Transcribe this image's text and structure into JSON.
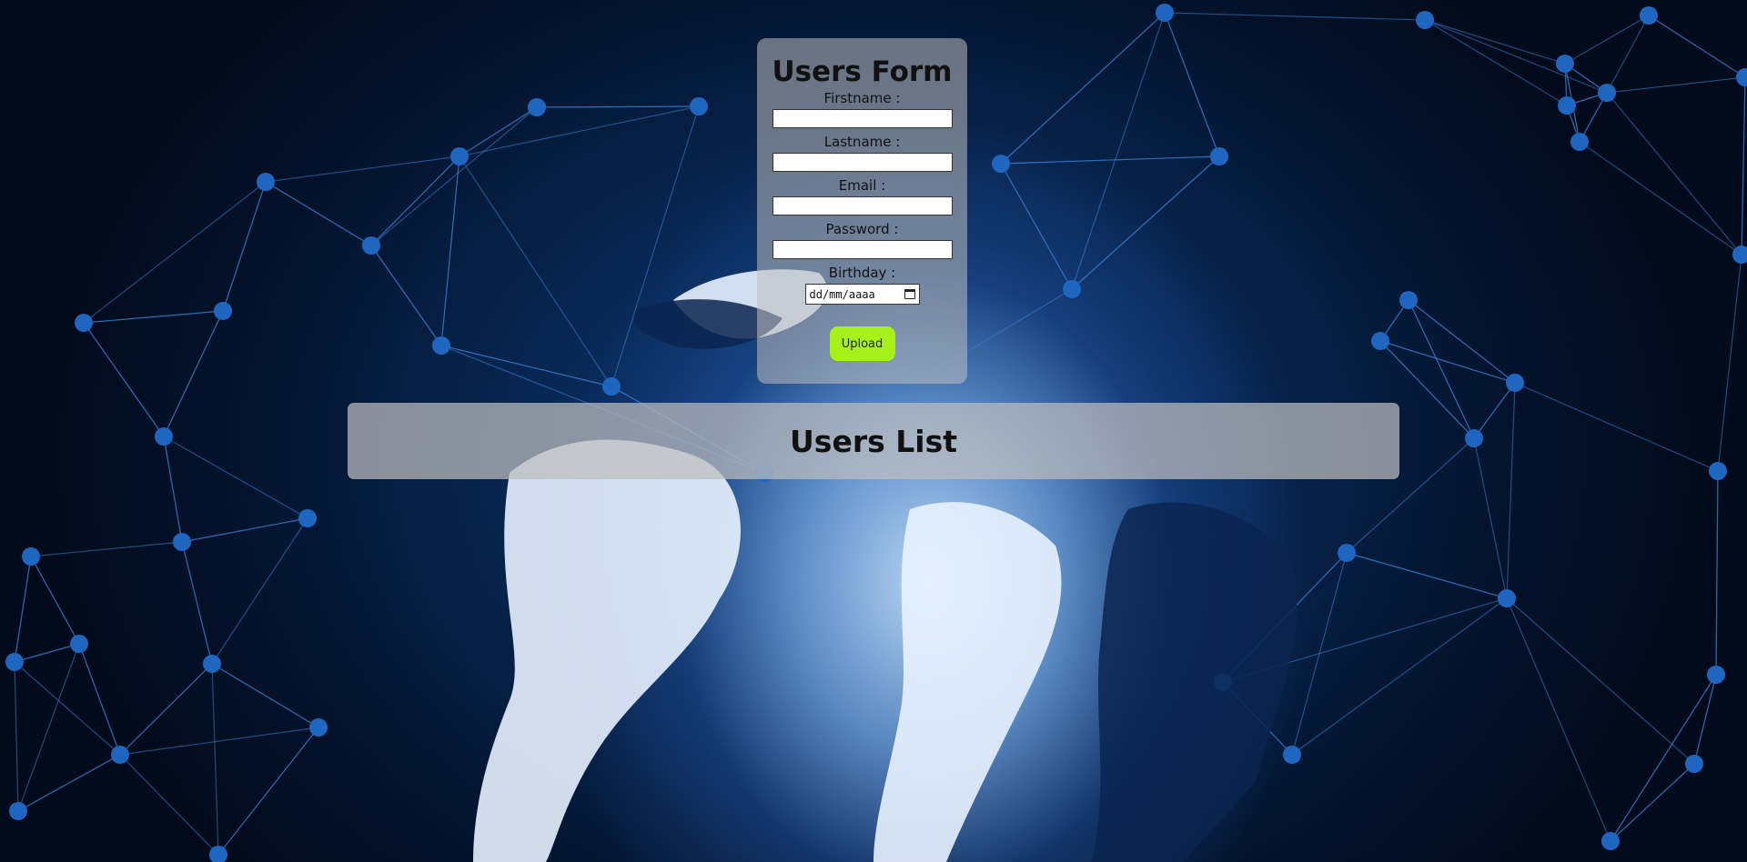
{
  "form": {
    "title": "Users Form",
    "fields": [
      {
        "label": "Firstname :",
        "value": ""
      },
      {
        "label": "Lastname :",
        "value": ""
      },
      {
        "label": "Email :",
        "value": ""
      },
      {
        "label": "Password :",
        "value": ""
      }
    ],
    "birthday": {
      "label": "Birthday :",
      "placeholder": "dd/mm/aaaa",
      "icon": "calendar-icon"
    },
    "upload_label": "Upload"
  },
  "list": {
    "title": "Users List"
  },
  "colors": {
    "upload_button": "#a6f11a",
    "card_background": "#bebebe",
    "background_dark": "#03122a",
    "network_node": "#2a6fc4"
  }
}
